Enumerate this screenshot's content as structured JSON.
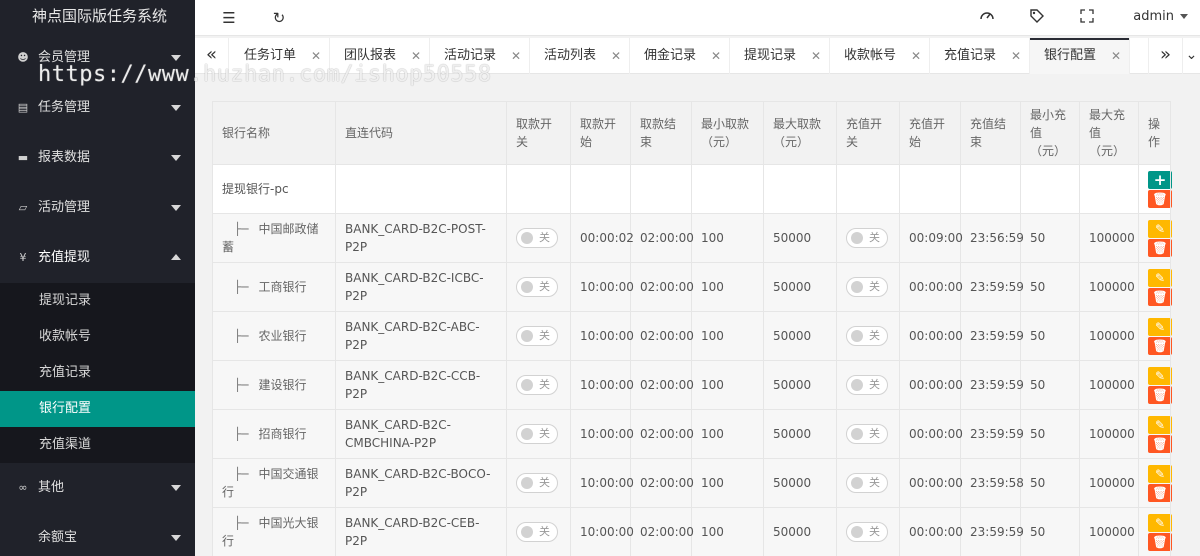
{
  "app": {
    "title": "神点国际版任务系统"
  },
  "watermark": "https://www.huzhan.com/ishop50558",
  "sidebar": {
    "items": [
      {
        "label": "会员管理",
        "icon": "user-icon"
      },
      {
        "label": "任务管理",
        "icon": "list-icon"
      },
      {
        "label": "报表数据",
        "icon": "report-icon"
      },
      {
        "label": "活动管理",
        "icon": "book-icon"
      },
      {
        "label": "充值提现",
        "icon": "yen-icon"
      },
      {
        "label": "其他",
        "icon": "infinity-icon"
      },
      {
        "label": "余额宝",
        "icon": "wallet-icon"
      }
    ],
    "submenu": [
      {
        "label": "提现记录"
      },
      {
        "label": "收款帐号"
      },
      {
        "label": "充值记录"
      },
      {
        "label": "银行配置",
        "active": true
      },
      {
        "label": "充值渠道"
      }
    ]
  },
  "header": {
    "user": "admin"
  },
  "tabs": [
    {
      "label": "任务订单"
    },
    {
      "label": "团队报表"
    },
    {
      "label": "活动记录"
    },
    {
      "label": "活动列表"
    },
    {
      "label": "佣金记录"
    },
    {
      "label": "提现记录"
    },
    {
      "label": "收款帐号"
    },
    {
      "label": "充值记录"
    },
    {
      "label": "银行配置",
      "active": true
    }
  ],
  "table": {
    "columns": [
      "银行名称",
      "直连代码",
      "取款开关",
      "取款开始",
      "取款结束",
      "最小取款（元）",
      "最大取款（元）",
      "充值开关",
      "充值开始",
      "充值结束",
      "最小充值（元）",
      "最大充值（元）",
      "操作"
    ],
    "root": {
      "name": "提现银行-pc"
    },
    "switch_off_label": "关",
    "rows": [
      {
        "name": "中国邮政储蓄",
        "code": "BANK_CARD-B2C-POST-P2P",
        "w_start": "00:00:02",
        "w_end": "02:00:00",
        "w_min": "100",
        "w_max": "50000",
        "r_start": "00:09:00",
        "r_end": "23:56:59",
        "r_min": "50",
        "r_max": "100000"
      },
      {
        "name": "工商银行",
        "code": "BANK_CARD-B2C-ICBC-P2P",
        "w_start": "10:00:00",
        "w_end": "02:00:00",
        "w_min": "100",
        "w_max": "50000",
        "r_start": "00:00:00",
        "r_end": "23:59:59",
        "r_min": "50",
        "r_max": "100000"
      },
      {
        "name": "农业银行",
        "code": "BANK_CARD-B2C-ABC-P2P",
        "w_start": "10:00:00",
        "w_end": "02:00:00",
        "w_min": "100",
        "w_max": "50000",
        "r_start": "00:00:00",
        "r_end": "23:59:59",
        "r_min": "50",
        "r_max": "100000"
      },
      {
        "name": "建设银行",
        "code": "BANK_CARD-B2C-CCB-P2P",
        "w_start": "10:00:00",
        "w_end": "02:00:00",
        "w_min": "100",
        "w_max": "50000",
        "r_start": "00:00:00",
        "r_end": "23:59:59",
        "r_min": "50",
        "r_max": "100000"
      },
      {
        "name": "招商银行",
        "code": "BANK_CARD-B2C-CMBCHINA-P2P",
        "w_start": "10:00:00",
        "w_end": "02:00:00",
        "w_min": "100",
        "w_max": "50000",
        "r_start": "00:00:00",
        "r_end": "23:59:59",
        "r_min": "50",
        "r_max": "100000"
      },
      {
        "name": "中国交通银行",
        "code": "BANK_CARD-B2C-BOCO-P2P",
        "w_start": "10:00:00",
        "w_end": "02:00:00",
        "w_min": "100",
        "w_max": "50000",
        "r_start": "00:00:00",
        "r_end": "23:59:58",
        "r_min": "50",
        "r_max": "100000"
      },
      {
        "name": "中国光大银行",
        "code": "BANK_CARD-B2C-CEB-P2P",
        "w_start": "10:00:00",
        "w_end": "02:00:00",
        "w_min": "100",
        "w_max": "50000",
        "r_start": "00:00:00",
        "r_end": "23:59:59",
        "r_min": "50",
        "r_max": "100000"
      }
    ]
  },
  "colors": {
    "sidebar_bg": "#20222a",
    "active": "#009688",
    "delete": "#ff5722",
    "edit": "#ffb800"
  }
}
